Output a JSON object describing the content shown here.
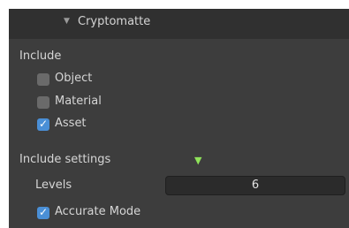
{
  "panel": {
    "title": "Cryptomatte",
    "include_label": "Include",
    "checkboxes": [
      {
        "label": "Object",
        "checked": false
      },
      {
        "label": "Material",
        "checked": false
      },
      {
        "label": "Asset",
        "checked": true
      }
    ],
    "include_settings_label": "Include settings",
    "levels_label": "Levels",
    "levels_value": "6",
    "accurate_mode": {
      "label": "Accurate Mode",
      "checked": true
    }
  },
  "colors": {
    "panel_bg": "#3d3d3d",
    "header_bg": "#303030",
    "checkbox_on": "#4a8fd6",
    "checkbox_off": "#6a6a6a",
    "indicator": "#8fe35a"
  },
  "icons": {
    "collapse": "chevron-down-icon",
    "check": "checkmark-icon",
    "indicator": "triangle-down-icon"
  }
}
